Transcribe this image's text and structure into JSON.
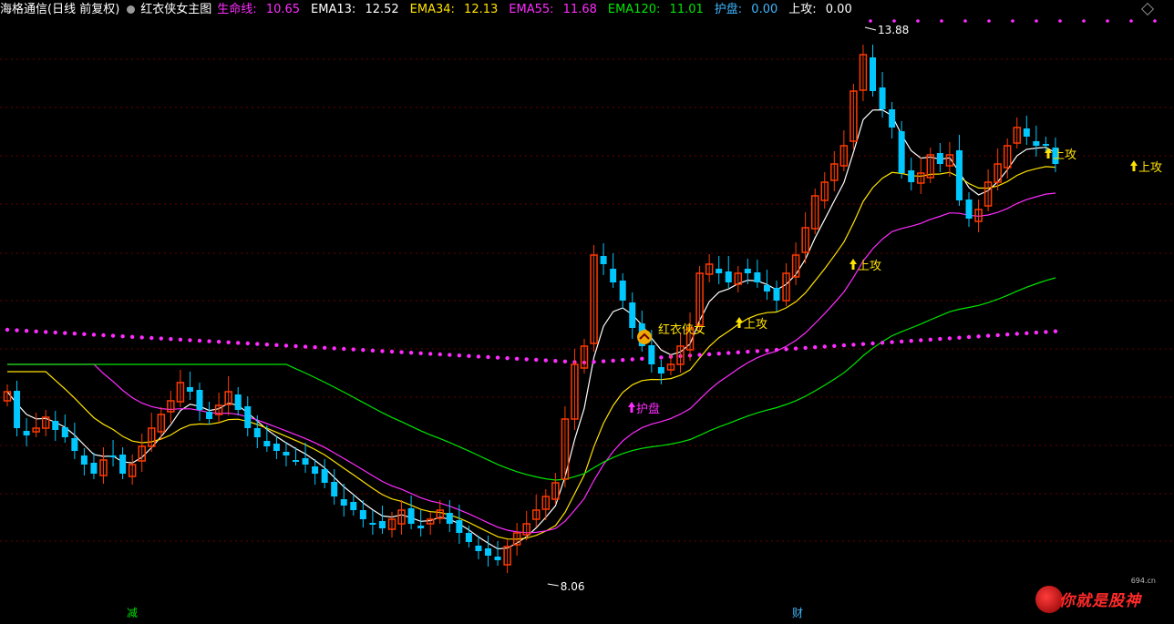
{
  "header": {
    "title": "海格通信(日线 前复权)",
    "indicator_name": "红衣侠女主图",
    "items": [
      {
        "label": "生命线:",
        "value": "10.65",
        "color": "#ff2cff"
      },
      {
        "label": "EMA13:",
        "value": "12.52",
        "color": "#ffffff"
      },
      {
        "label": "EMA34:",
        "value": "12.13",
        "color": "#ffe200"
      },
      {
        "label": "EMA55:",
        "value": "11.68",
        "color": "#ff2cff"
      },
      {
        "label": "EMA120:",
        "value": "11.01",
        "color": "#00e600"
      },
      {
        "label": "护盘:",
        "value": "0.00",
        "color": "#3fb7ff"
      },
      {
        "label": "上攻:",
        "value": "0.00",
        "color": "#ffffff"
      }
    ]
  },
  "chart_data": {
    "type": "candlestick",
    "up_color": "#ff3b00",
    "down_color": "#00c8ff",
    "high_label": "13.88",
    "low_label": "8.06",
    "signal_labels": {
      "hupan": "护盘",
      "shanggong": "上攻",
      "hongyi": "红衣侠女"
    },
    "bottom_marks": [
      {
        "text": "减",
        "color": "#00e000"
      },
      {
        "text": "财",
        "color": "#3fb7ff"
      }
    ],
    "colors": {
      "ema13": "#ffffff",
      "ema34": "#ffe200",
      "ema55": "#ff2cff",
      "ema120": "#00e600",
      "lifeline": "#ff2cff"
    }
  },
  "watermark": {
    "text": "你就是股神",
    "site": "694.cn"
  }
}
